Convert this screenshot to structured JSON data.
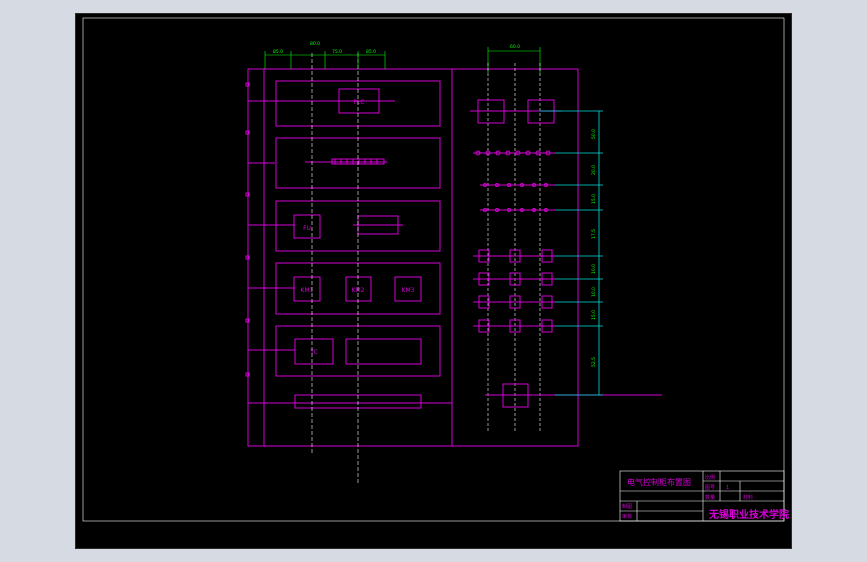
{
  "drawing": {
    "components": {
      "plc": "PLC",
      "terminal_strip": "",
      "fu": "FU",
      "km1": "KM1",
      "km2": "KM2",
      "km3": "KM3",
      "tc": "TC",
      "transformer": "",
      "bottom_bar": "",
      "right_top_left": "",
      "right_top_right": "",
      "right_bottom": ""
    },
    "dims": {
      "top_left": "85.0",
      "top_mid": "80.0",
      "top_center": "75.0",
      "top_right": "85.0",
      "right_top": "60.0",
      "v1": "50.0",
      "v2": "20.0",
      "v3": "15.0",
      "v4": "17.5",
      "v5": "10.0",
      "v6": "10.0",
      "v7": "15.0",
      "v8": "52.5"
    },
    "title_block": {
      "drawing_name": "电气控制柜布置图",
      "row_labels": [
        "比例",
        "图号",
        "数量"
      ],
      "scale_value": "1",
      "material_label": "材料",
      "left_labels": [
        "制图",
        "审核"
      ],
      "school": "无锡职业技术学院"
    }
  }
}
